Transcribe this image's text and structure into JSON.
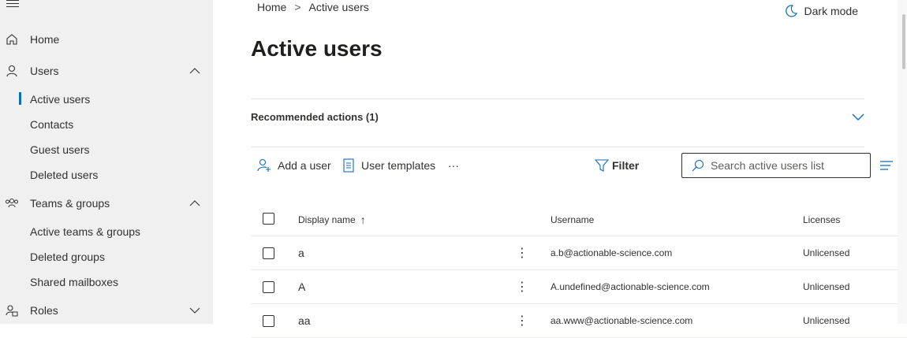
{
  "sidebar": {
    "items": [
      {
        "label": "Home"
      },
      {
        "label": "Users"
      },
      {
        "label": "Active users"
      },
      {
        "label": "Contacts"
      },
      {
        "label": "Guest users"
      },
      {
        "label": "Deleted users"
      },
      {
        "label": "Teams & groups"
      },
      {
        "label": "Active teams & groups"
      },
      {
        "label": "Deleted groups"
      },
      {
        "label": "Shared mailboxes"
      },
      {
        "label": "Roles"
      }
    ]
  },
  "header": {
    "breadcrumb": [
      "Home",
      "Active users"
    ],
    "dark_mode_label": "Dark mode",
    "title": "Active users"
  },
  "recommended": {
    "label": "Recommended actions (1)"
  },
  "toolbar": {
    "add_user": "Add a user",
    "user_templates": "User templates",
    "more": "···",
    "filter": "Filter",
    "search_placeholder": "Search active users list"
  },
  "table": {
    "columns": {
      "display_name": "Display name",
      "username": "Username",
      "licenses": "Licenses"
    },
    "sort_indicator": "↑",
    "rows": [
      {
        "name": "a",
        "username": "a.b@actionable-science.com",
        "license": "Unlicensed"
      },
      {
        "name": "A",
        "username": "A.undefined@actionable-science.com",
        "license": "Unlicensed"
      },
      {
        "name": "aa",
        "username": "aa.www@actionable-science.com",
        "license": "Unlicensed"
      }
    ]
  },
  "colors": {
    "accent": "#0f6cbd",
    "sidebar_bg": "#f0f0f0"
  }
}
